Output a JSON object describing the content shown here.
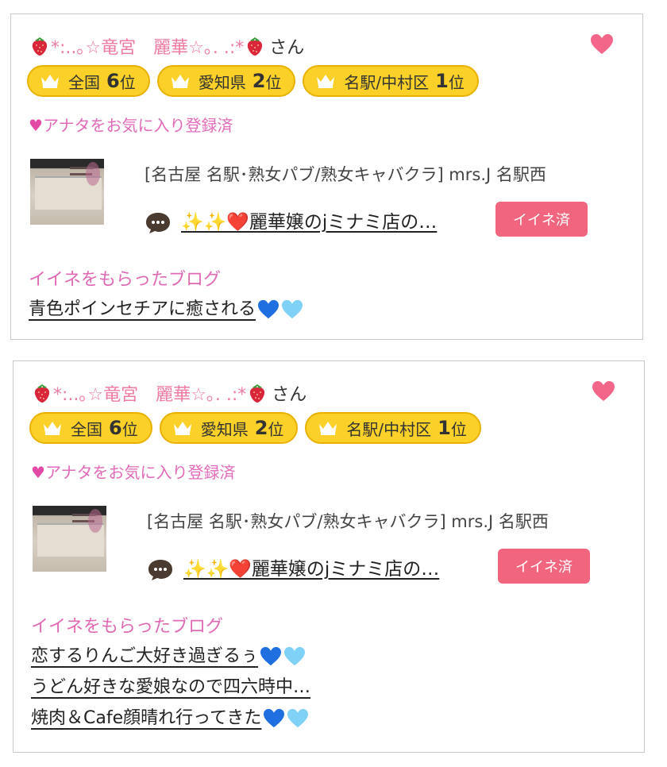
{
  "cards": [
    {
      "name_prefix": "*:..｡☆竜宮　麗華☆｡. .:*",
      "name_suffix": "さん",
      "ranks": [
        {
          "area": "全国",
          "rank": "6",
          "unit": "位"
        },
        {
          "area": "愛知県",
          "rank": "2",
          "unit": "位"
        },
        {
          "area": "名駅/中村区",
          "rank": "1",
          "unit": "位"
        }
      ],
      "favorite_status": "アナタをお気に入り登録済",
      "shop": "[名古屋 名駅･熟女パブ/熟女キャバクラ]  mrs.J 名駅西",
      "post_title": "✨✨❤️麗華嬢のjミナミ店の…",
      "like_button": "イイネ済",
      "section_title": "イイネをもらったブログ",
      "blogs": [
        {
          "title": "青色ポインセチアに癒される",
          "hearts": true
        }
      ]
    },
    {
      "name_prefix": "*:..｡☆竜宮　麗華☆｡. .:*",
      "name_suffix": "さん",
      "ranks": [
        {
          "area": "全国",
          "rank": "6",
          "unit": "位"
        },
        {
          "area": "愛知県",
          "rank": "2",
          "unit": "位"
        },
        {
          "area": "名駅/中村区",
          "rank": "1",
          "unit": "位"
        }
      ],
      "favorite_status": "アナタをお気に入り登録済",
      "shop": "[名古屋 名駅･熟女パブ/熟女キャバクラ]  mrs.J 名駅西",
      "post_title": "✨✨❤️麗華嬢のjミナミ店の…",
      "like_button": "イイネ済",
      "section_title": "イイネをもらったブログ",
      "blogs": [
        {
          "title": "恋するりんご大好き過ぎるぅ",
          "hearts": true
        },
        {
          "title": "うどん好きな愛娘なので四六時中…",
          "hearts": false
        },
        {
          "title": "焼肉＆Cafe顔晴れ行ってきた",
          "hearts": true
        }
      ]
    }
  ],
  "colors": {
    "pink_text": "#f07ba0",
    "badge_yellow": "#fbd028",
    "like_button": "#f1657f",
    "heart_pink": "#f3668a"
  }
}
